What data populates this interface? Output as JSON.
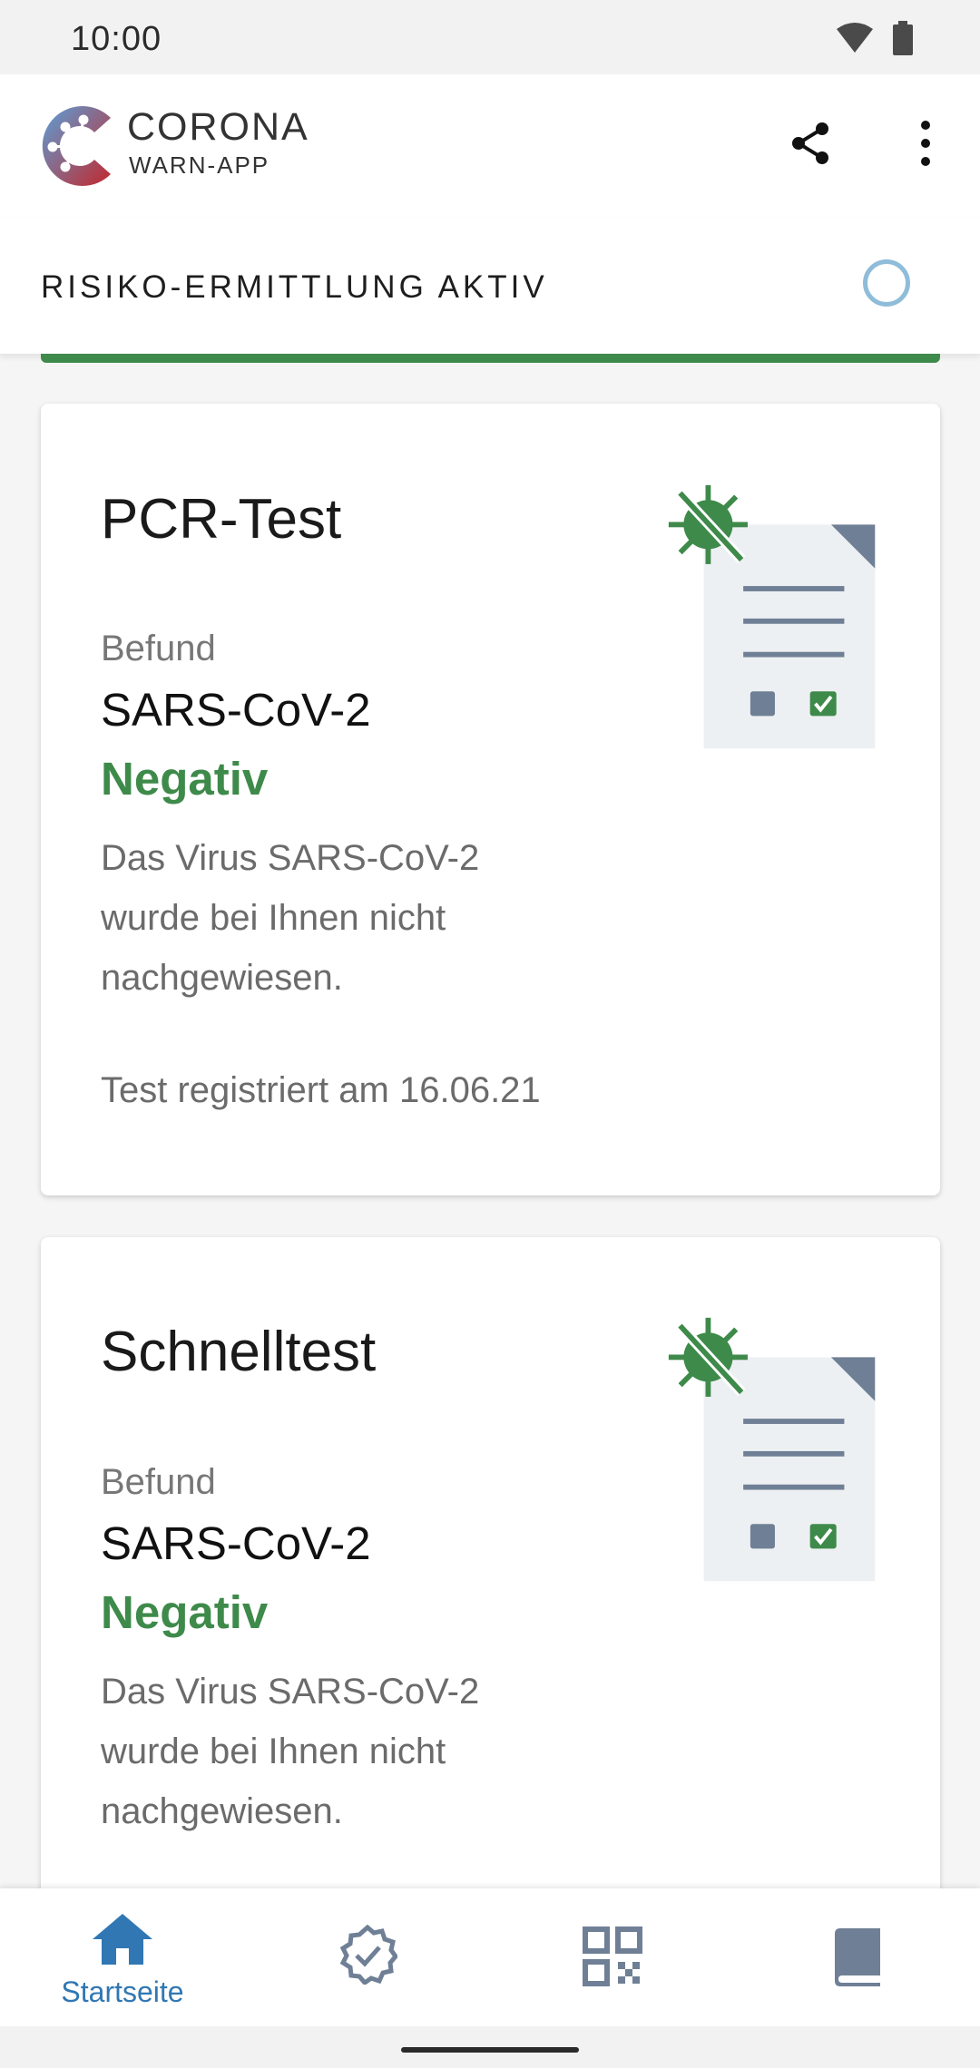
{
  "status_bar": {
    "time": "10:00"
  },
  "header": {
    "brand_title": "CORONA",
    "brand_subtitle": "WARN-APP",
    "share_icon": "share-icon",
    "more_icon": "more-vert-icon"
  },
  "risk": {
    "label": "RISIKO-ERMITTLUNG AKTIV"
  },
  "cards": [
    {
      "title": "PCR-Test",
      "label": "Befund",
      "pathogen": "SARS-CoV-2",
      "result": "Negativ",
      "description": "Das Virus SARS-CoV-2 wurde bei Ihnen nicht nachgewiesen.",
      "date": "Test registriert am 16.06.21"
    },
    {
      "title": "Schnelltest",
      "label": "Befund",
      "pathogen": "SARS-CoV-2",
      "result": "Negativ",
      "description": "Das Virus SARS-CoV-2 wurde bei Ihnen nicht nachgewiesen."
    }
  ],
  "nav": {
    "home_label": "Startseite",
    "items": [
      "home-icon",
      "certificate-icon",
      "qr-code-icon",
      "diary-icon"
    ]
  },
  "colors": {
    "accent_blue": "#3077b3",
    "negative_green": "#3e8a4a",
    "spinner": "#8fbdd9"
  }
}
